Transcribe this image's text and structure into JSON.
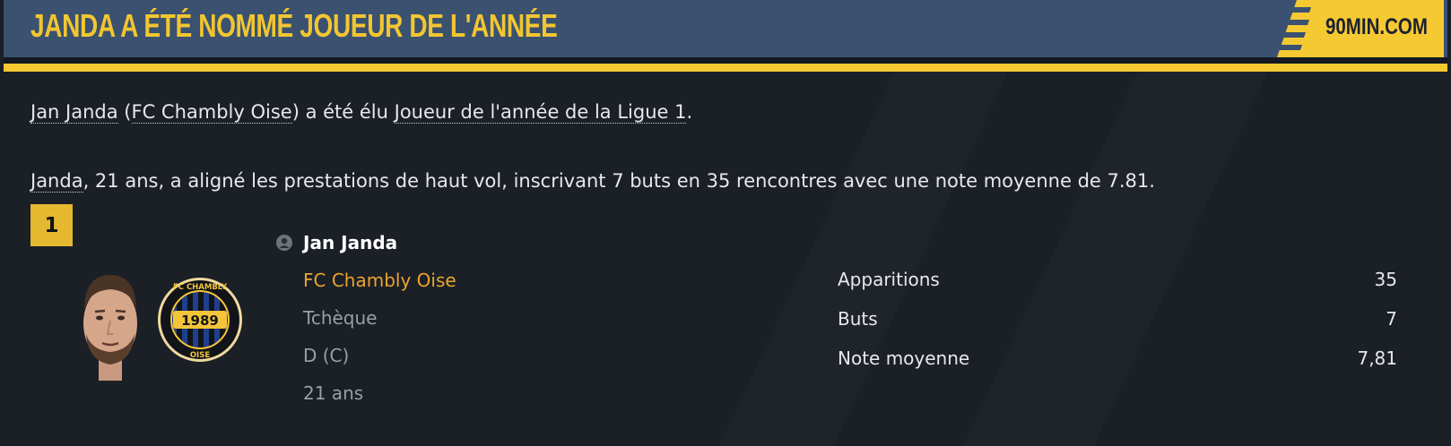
{
  "header": {
    "headline": "JANDA A ÉTÉ NOMMÉ JOUEUR DE L'ANNÉE",
    "brand": "90MIN.COM"
  },
  "article": {
    "p1": {
      "player_link": "Jan Janda",
      "open_paren": " (",
      "club_link": "FC Chambly Oise",
      "middle": ") a été élu ",
      "award_link": "Joueur de l'année de la Ligue 1",
      "end": "."
    },
    "p2": {
      "player_link": "Janda",
      "text": ", 21 ans, a aligné les prestations de haut vol, inscrivant 7 buts en 35 rencontres avec une note moyenne de 7.81."
    }
  },
  "rank": "1",
  "player": {
    "name": "Jan Janda",
    "club": "FC Chambly Oise",
    "nationality": "Tchèque",
    "position": "D (C)",
    "age": "21 ans",
    "crest_top": "FC CHAMBLY",
    "crest_year": "1989",
    "crest_bottom": "OISE"
  },
  "stats": [
    {
      "label": "Apparitions",
      "value": "35"
    },
    {
      "label": "Buts",
      "value": "7"
    },
    {
      "label": "Note moyenne",
      "value": "7,81"
    }
  ],
  "colors": {
    "accent_yellow": "#f5c932",
    "header_blue": "#3a5170",
    "club_orange": "#eaa52d",
    "background": "#1b1f26"
  },
  "icons": {
    "player_icon": "person-icon"
  }
}
